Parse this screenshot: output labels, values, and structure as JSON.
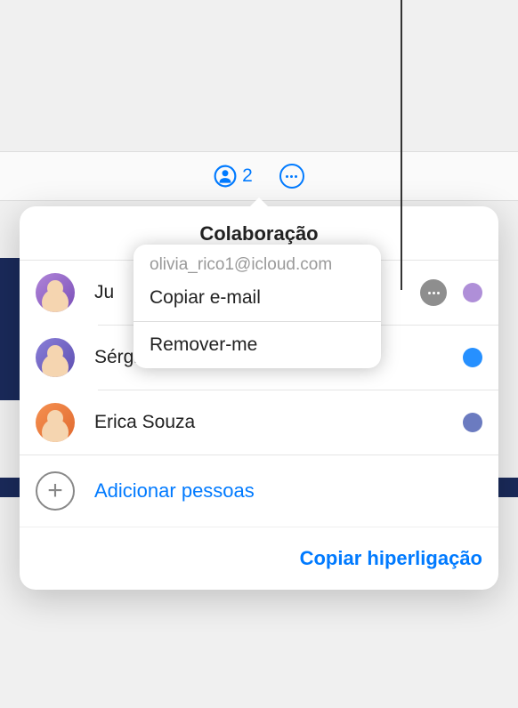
{
  "toolbar": {
    "collab_count": "2"
  },
  "popover": {
    "title": "Colaboração",
    "participants": [
      {
        "name": "Ju",
        "dot": "purple",
        "has_more": true
      },
      {
        "name": "Sérgio Souza (proprietário)",
        "dot": "blue",
        "has_more": false
      },
      {
        "name": "Erica Souza",
        "dot": "slate",
        "has_more": false
      }
    ],
    "add_label": "Adicionar pessoas",
    "copy_link_label": "Copiar hiperligação"
  },
  "context_menu": {
    "email": "olivia_rico1@icloud.com",
    "copy_email": "Copiar e-mail",
    "remove_me": "Remover-me"
  }
}
